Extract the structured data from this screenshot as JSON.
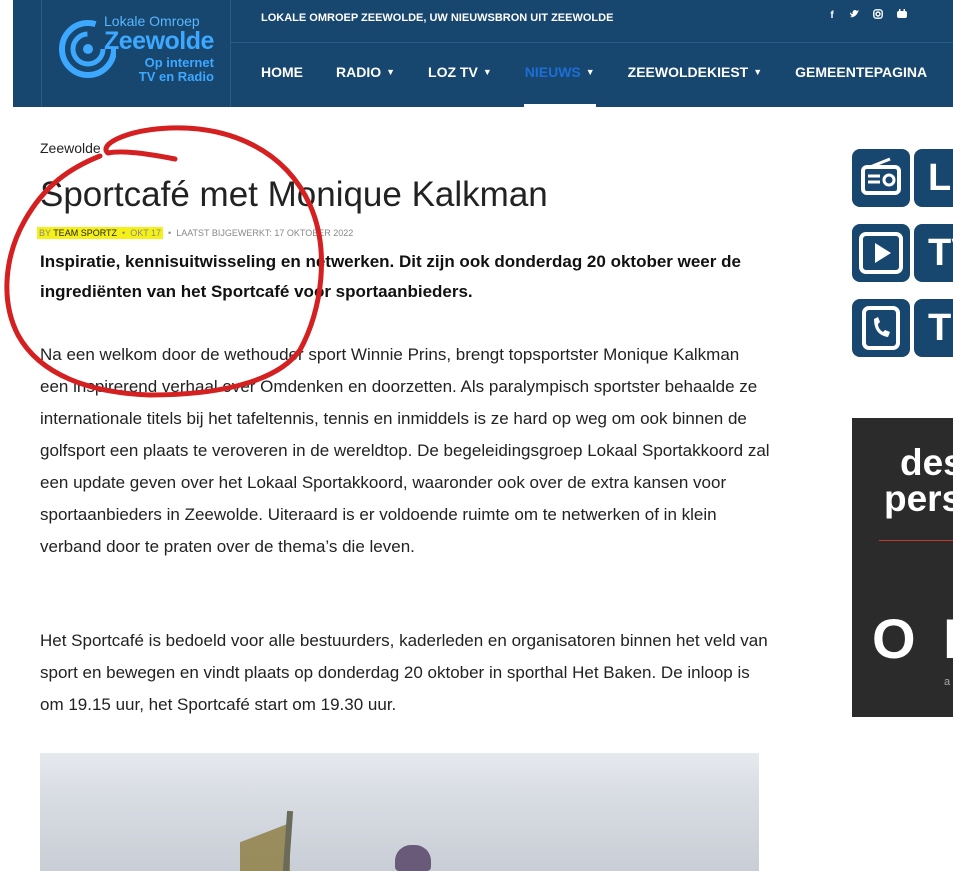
{
  "header": {
    "logo": {
      "line1": "Lokale Omroep",
      "line2": "Zeewolde",
      "line3": "Op internet",
      "line4": "TV en Radio"
    },
    "tagline": "LOKALE OMROEP ZEEWOLDE, UW NIEUWSBRON UIT ZEEWOLDE",
    "social": [
      "facebook-icon",
      "twitter-icon",
      "instagram-icon",
      "youtube-icon"
    ],
    "nav": [
      {
        "label": "HOME",
        "dropdown": false
      },
      {
        "label": "RADIO",
        "dropdown": true
      },
      {
        "label": "LOZ TV",
        "dropdown": true
      },
      {
        "label": "NIEUWS",
        "dropdown": true,
        "active": true
      },
      {
        "label": "ZEEWOLDEKIEST",
        "dropdown": true
      },
      {
        "label": "GEMEENTEPAGINA",
        "dropdown": false
      }
    ],
    "colors": {
      "bar": "#17466f",
      "active": "#1c6fd6"
    }
  },
  "article": {
    "breadcrumb": "Zeewolde",
    "title": "Sportcafé met Monique Kalkman",
    "meta": {
      "by": "BY",
      "author": "TEAM SPORTZ",
      "date": "OKT 17",
      "updated": "LAATST BIJGEWERKT: 17 OKTOBER 2022"
    },
    "lead": "Inspiratie, kennisuitwisseling en netwerken. Dit zijn ook donderdag 20 oktober weer de ingrediënten van het Sportcafé voor sportaanbieders.",
    "paragraphs": [
      "Na een welkom door de wethouder sport Winnie Prins, brengt topsportster Monique Kalkman een inspirerend verhaal over Omdenken en doorzetten. Als paralympisch sportster behaalde ze internationale titels bij het tafeltennis, tennis en inmiddels is ze hard op weg om ook binnen de golfsport een plaats te veroveren in de wereldtop. De begeleidingsgroep Lokaal Sportakkoord zal een update geven over het Lokaal Sportakkoord, waaronder ook over de extra kansen voor sportaanbieders in Zeewolde. Uiteraard is er voldoende ruimte om te netwerken of in klein verband door te praten over de thema’s die leven.",
      "Het Sportcafé is bedoeld voor alle bestuurders, kaderleden en organisatoren binnen het veld van sport en bewegen en vindt plaats op donderdag 20 oktober in sporthal Het Baken. De inloop is om 19.15 uur, het Sportcafé start om 19.30 uur."
    ]
  },
  "sidebar": {
    "buttons": [
      {
        "icon": "radio-icon",
        "label": "Lu"
      },
      {
        "icon": "play-icon",
        "label": "TV"
      },
      {
        "icon": "phone-icon",
        "label": "Ti"
      }
    ],
    "ad": {
      "line1": "des",
      "line2": "pers",
      "big": "O B",
      "small": "a"
    }
  },
  "annotation": {
    "highlight_color": "#f5f117",
    "circle_color": "#d42020"
  }
}
